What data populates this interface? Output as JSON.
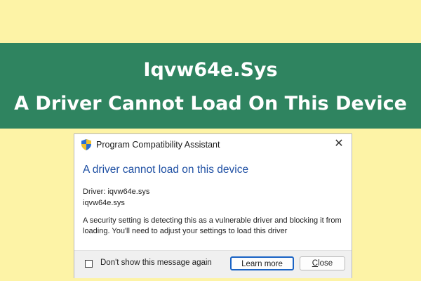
{
  "banner": {
    "line1": "Iqvw64e.Sys",
    "line2": "A Driver Cannot Load On This Device"
  },
  "dialog": {
    "title": "Program Compatibility Assistant",
    "close_glyph": "✕",
    "heading": "A driver cannot load on this device",
    "driver_line": "Driver: iqvw64e.sys",
    "driver_file": "iqvw64e.sys",
    "message": "A security setting is detecting this as a vulnerable driver and blocking it from loading. You'll need to adjust your settings to load this driver",
    "checkbox_label": "Don't show this message again",
    "learn_more_label": "Learn more",
    "close_label_first": "C",
    "close_label_rest": "lose"
  },
  "colors": {
    "background": "#fdf3a6",
    "banner": "#2f8460",
    "heading": "#1e4fa3",
    "button_focus": "#1a63c4"
  },
  "icons": {
    "title_icon": "shield-icon",
    "close_icon": "close-icon"
  }
}
